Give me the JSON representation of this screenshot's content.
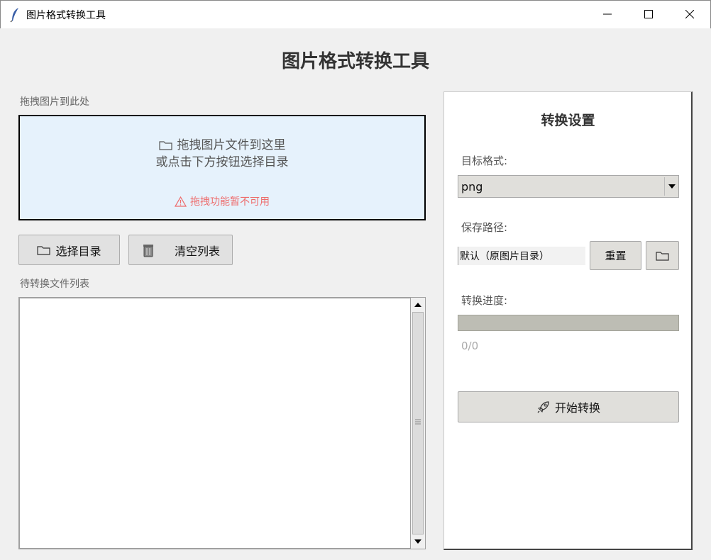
{
  "window": {
    "title": "图片格式转换工具"
  },
  "header": {
    "title": "图片格式转换工具"
  },
  "drop_area": {
    "section_label": "拖拽图片到此处",
    "line1": "拖拽图片文件到这里",
    "line2": "或点击下方按钮选择目录",
    "warning": "拖拽功能暂不可用"
  },
  "buttons": {
    "select_dir": "选择目录",
    "clear_list": "清空列表"
  },
  "file_list": {
    "label": "待转换文件列表",
    "items": []
  },
  "settings": {
    "title": "转换设置",
    "target_format_label": "目标格式:",
    "target_format_value": "png",
    "save_path_label": "保存路径:",
    "save_path_value": "默认（原图片目录）",
    "reset_label": "重置",
    "progress_label": "转换进度:",
    "progress_value": 0,
    "progress_text": "0/0",
    "start_label": "开始转换"
  },
  "colors": {
    "drop_zone_bg": "#e6f2fc",
    "warning": "#ee6b6b",
    "panel_bg": "#ffffff",
    "button_bg": "#e0dfdb"
  },
  "icons": {
    "app": "feather-icon",
    "folder": "folder-icon",
    "warning": "warning-triangle-icon",
    "trash": "trash-icon",
    "rocket": "rocket-icon"
  }
}
